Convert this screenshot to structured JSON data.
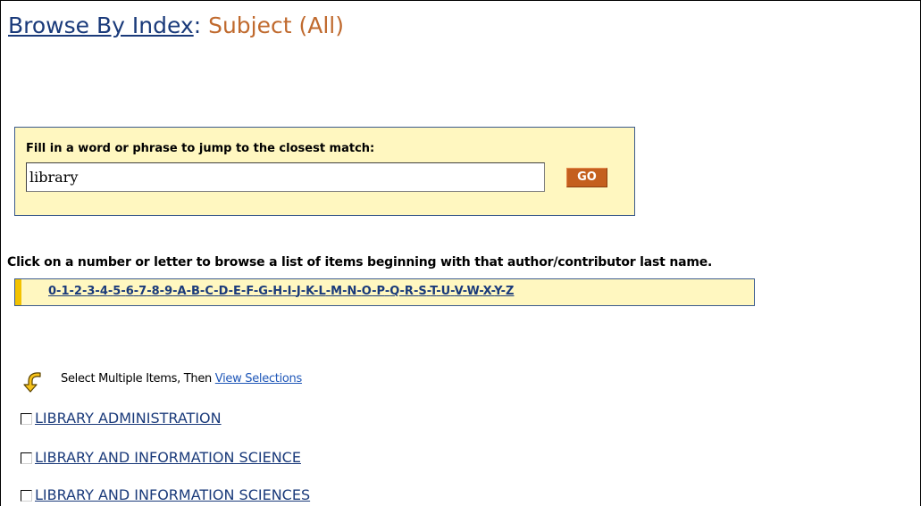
{
  "title": {
    "link": "Browse By Index",
    "separator": ":",
    "subject": " Subject (All)"
  },
  "search": {
    "label": "Fill in a word or phrase to jump to the closest match:",
    "value": "library",
    "go_label": "GO"
  },
  "browse": {
    "instruction": "Click on a number or letter to browse a list of items beginning with that author/contributor last name.",
    "letters": [
      "0",
      "1",
      "2",
      "3",
      "4",
      "5",
      "6",
      "7",
      "8",
      "9",
      "A",
      "B",
      "C",
      "D",
      "E",
      "F",
      "G",
      "H",
      "I",
      "J",
      "K",
      "L",
      "M",
      "N",
      "O",
      "P",
      "Q",
      "R",
      "S",
      "T",
      "U",
      "V",
      "W",
      "X",
      "Y",
      "Z"
    ]
  },
  "multi_select": {
    "text": "Select Multiple Items, Then ",
    "link": "View Selections",
    "icon": "curved-arrow-down-icon"
  },
  "results": [
    {
      "label": "LIBRARY ADMINISTRATION",
      "checked": false
    },
    {
      "label": "LIBRARY AND INFORMATION SCIENCE",
      "checked": false
    },
    {
      "label": "LIBRARY AND INFORMATION SCIENCES",
      "checked": false
    }
  ],
  "colors": {
    "link_navy": "#1a3a7a",
    "subject_orange": "#c06a2e",
    "box_yellow": "#fff7c0",
    "go_orange": "#c45f1e",
    "accent_gold": "#f2c200"
  }
}
